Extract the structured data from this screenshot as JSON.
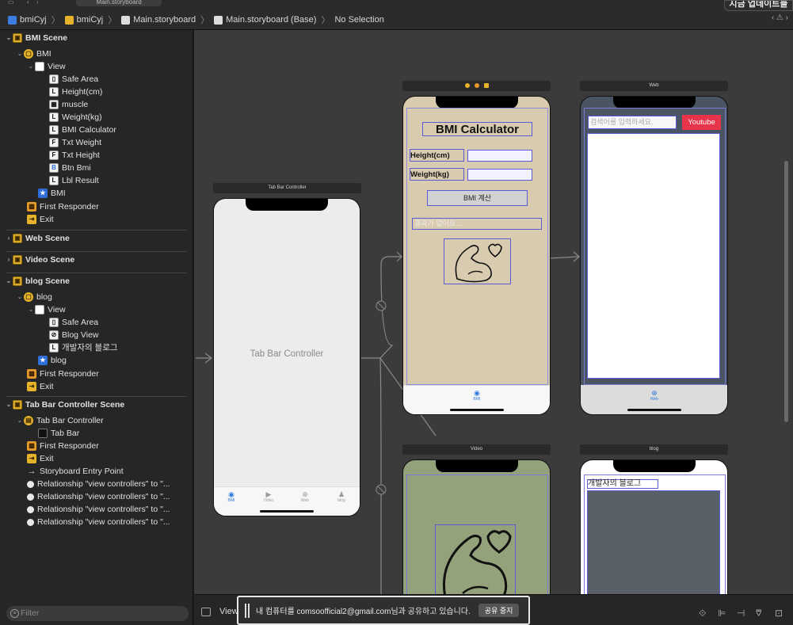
{
  "tabstrip": {
    "tab_label": "Main.storyboard"
  },
  "update_popup": {
    "label": "지금 업데이트들"
  },
  "breadcrumb": [
    "bmiCyj",
    "bmiCyj",
    "Main.storyboard",
    "Main.storyboard (Base)",
    "No Selection"
  ],
  "navigator": {
    "bmi_scene": {
      "title": "BMI Scene",
      "vc": "BMI",
      "view": "View",
      "children": [
        "Safe Area",
        "Height(cm)",
        "muscle",
        "Weight(kg)",
        "BMI Calculator",
        "Txt Weight",
        "Txt Height",
        "Btn Bmi",
        "Lbl Result"
      ],
      "child_icons": [
        "▯",
        "L",
        "▦",
        "L",
        "L",
        "F",
        "F",
        "B",
        "L"
      ],
      "tab_item": "BMI",
      "first_responder": "First Responder",
      "exit": "Exit"
    },
    "web_scene": {
      "title": "Web Scene"
    },
    "video_scene": {
      "title": "Video Scene"
    },
    "blog_scene": {
      "title": "blog Scene",
      "vc": "blog",
      "view": "View",
      "children": [
        "Safe Area",
        "Blog View",
        "개발자의 블로그"
      ],
      "child_icons": [
        "▯",
        "⊘",
        "L"
      ],
      "tab_item": "blog",
      "first_responder": "First Responder",
      "exit": "Exit"
    },
    "tabbar_scene": {
      "title": "Tab Bar Controller Scene",
      "vc": "Tab Bar Controller",
      "tab_bar": "Tab Bar",
      "first_responder": "First Responder",
      "exit": "Exit",
      "entry_point": "Storyboard Entry Point",
      "relationships": [
        "Relationship \"view controllers\" to \"...",
        "Relationship \"view controllers\" to \"...",
        "Relationship \"view controllers\" to \"...",
        "Relationship \"view controllers\" to \"..."
      ]
    },
    "filter_placeholder": "Filter"
  },
  "canvas": {
    "tabbar_controller": {
      "header": "Tab Bar Controller",
      "center_label": "Tab Bar Controller",
      "tabs": [
        "BMI",
        "Video",
        "Web",
        "blog"
      ]
    },
    "bmi": {
      "title": "BMI Calculator",
      "height_label": "Height(cm)",
      "weight_label": "Weight(kg)",
      "button": "BMI 계산",
      "result": "결과가 없어요...",
      "tab": "BMI",
      "bg": "#d9cbb0"
    },
    "web": {
      "header": "Web",
      "search_placeholder": "검색어를 입력하세요.",
      "youtube_button": "Youtube",
      "tab": "Web",
      "youtube_color": "#e8344a"
    },
    "video": {
      "header": "Video",
      "bg": "#93a27a"
    },
    "blog": {
      "header": "blog",
      "label": "개발자의 블로그"
    }
  },
  "bottom": {
    "view_as": "View",
    "share_text": "내 컴퓨터를 comsoofficial2@gmail.com님과 공유하고 있습니다.",
    "share_stop": "공유 중지"
  }
}
